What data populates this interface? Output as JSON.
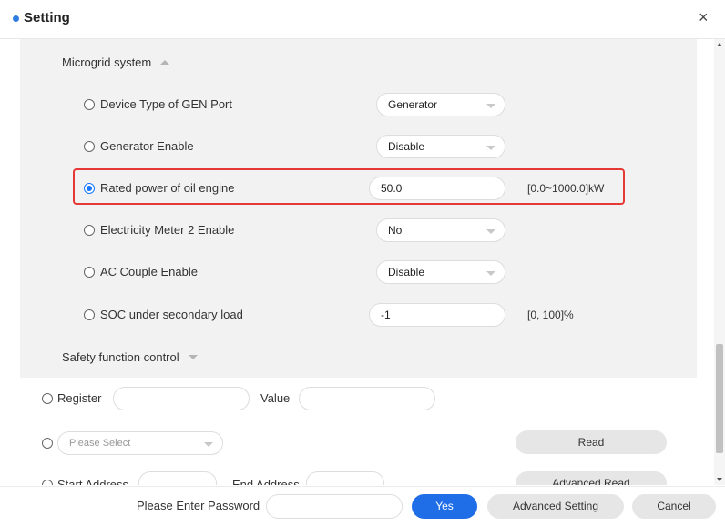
{
  "header": {
    "title": "Setting",
    "close": "×"
  },
  "microgrid": {
    "title": "Microgrid system",
    "rows": [
      {
        "label": "Device Type of GEN Port",
        "value": "Generator"
      },
      {
        "label": "Generator Enable",
        "value": "Disable"
      },
      {
        "label": "Rated power of oil engine",
        "value": "50.0",
        "range": "[0.0~1000.0]kW",
        "selected": true
      },
      {
        "label": "Electricity Meter 2 Enable",
        "value": "No"
      },
      {
        "label": "AC Couple Enable",
        "value": "Disable"
      },
      {
        "label": "SOC under secondary load",
        "value": "-1",
        "range": "[0, 100]%"
      }
    ]
  },
  "safety": {
    "title": "Safety function control"
  },
  "register": {
    "register_label": "Register",
    "value_label": "Value",
    "select_placeholder": "Please Select",
    "read_button": "Read",
    "start_address_label": "Start Address",
    "end_address_label": "End Address",
    "advanced_read_button": "Advanced Read"
  },
  "footer": {
    "password_label": "Please Enter Password",
    "yes_button": "Yes",
    "advanced_setting_button": "Advanced Setting",
    "cancel_button": "Cancel"
  },
  "colors": {
    "accent": "#1f6ee8",
    "highlight": "#e53935",
    "panel": "#f2f2f2"
  }
}
